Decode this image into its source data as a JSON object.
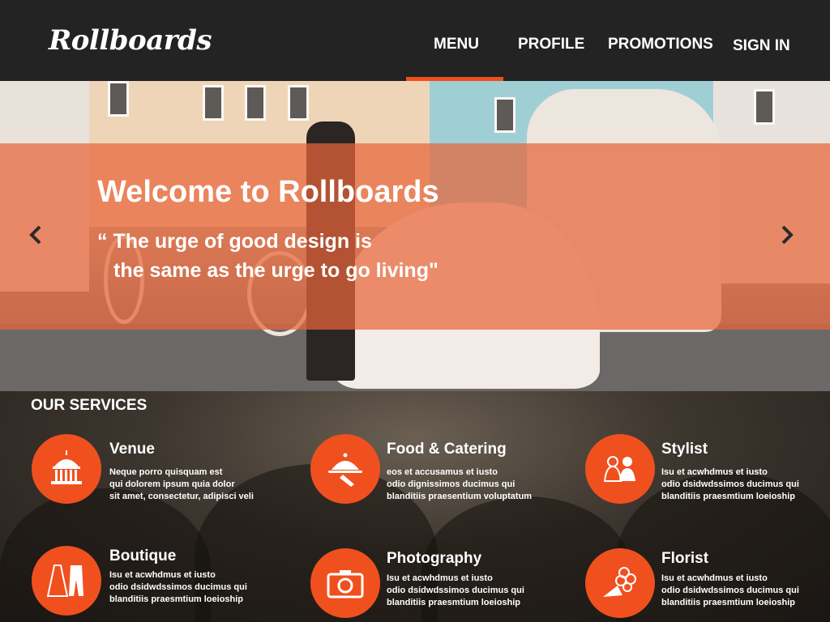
{
  "brand": {
    "logo": "Rollboards",
    "accent": "#f0501e"
  },
  "nav": {
    "items": [
      {
        "label": "MENU",
        "active": true
      },
      {
        "label": "PROFILE",
        "active": false
      },
      {
        "label": "PROMOTIONS",
        "active": false
      },
      {
        "label": "SIGN IN",
        "active": false
      }
    ]
  },
  "hero": {
    "title": "Welcome to Rollboards",
    "quote_line1": "“ The urge of good design is",
    "quote_line2": "the same as the urge to go living\"",
    "prev_icon": "chevron-left-icon",
    "next_icon": "chevron-right-icon"
  },
  "services": {
    "title": "OUR SERVICES",
    "items": [
      {
        "title": "Venue",
        "icon": "building-icon",
        "desc": "Neque porro quisquam est\nqui dolorem ipsum quia dolor\nsit amet, consectetur, adipisci veli"
      },
      {
        "title": "Food & Catering",
        "icon": "serving-tray-icon",
        "desc": "eos et accusamus et iusto\nodio dignissimos ducimus qui\nblanditiis praesentium voluptatum"
      },
      {
        "title": "Stylist",
        "icon": "bride-groom-icon",
        "desc": "Isu et acwhdmus et iusto\nodio dsidwdssimos ducimus qui\nblanditiis praesmtium loeioship"
      },
      {
        "title": "Boutique",
        "icon": "dress-suit-icon",
        "desc": "Isu et acwhdmus et iusto\nodio dsidwdssimos ducimus qui\nblanditiis praesmtium loeioship"
      },
      {
        "title": "Photography",
        "icon": "camera-icon",
        "desc": "Isu et acwhdmus et iusto\nodio dsidwdssimos ducimus qui\nblanditiis praesmtium loeioship"
      },
      {
        "title": "Florist",
        "icon": "bouquet-icon",
        "desc": "Isu et acwhdmus et iusto\nodio dsidwdssimos ducimus qui\nblanditiis praesmtium loeioship"
      }
    ]
  }
}
